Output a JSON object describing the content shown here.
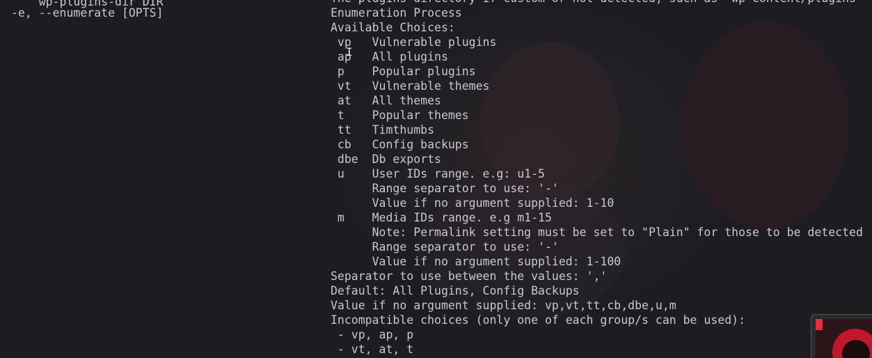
{
  "terminal": {
    "left_column": [
      "    wp-plugins-dir DIR",
      "-e, --enumerate [OPTS]"
    ],
    "right_column": [
      "The plugins directory if custom or not detected, such as \"wp-content/plugins\"",
      "Enumeration Process",
      "Available Choices:",
      " vp   Vulnerable plugins",
      " ap   All plugins",
      " p    Popular plugins",
      " vt   Vulnerable themes",
      " at   All themes",
      " t    Popular themes",
      " tt   Timthumbs",
      " cb   Config backups",
      " dbe  Db exports",
      " u    User IDs range. e.g: u1-5",
      "      Range separator to use: '-'",
      "      Value if no argument supplied: 1-10",
      " m    Media IDs range. e.g m1-15",
      "      Note: Permalink setting must be set to \"Plain\" for those to be detected",
      "      Range separator to use: '-'",
      "      Value if no argument supplied: 1-100",
      "Separator to use between the values: ','",
      "Default: All Plugins, Config Backups",
      "Value if no argument supplied: vp,vt,tt,cb,dbe,u,m",
      "Incompatible choices (only one of each group/s can be used):",
      " - vp, ap, p",
      " - vt, at, t"
    ],
    "cursor_glyph": "I",
    "text_color": "#c9c9cf",
    "background_color": "#1c1c21"
  },
  "overlay": {
    "thumbnail_icon": "app-thumbnail-icon",
    "accent_color": "#e0303a"
  }
}
